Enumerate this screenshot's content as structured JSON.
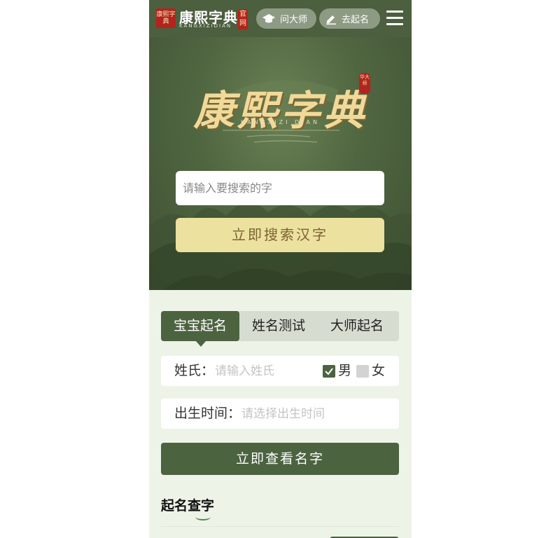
{
  "header": {
    "logo_seal": "康熙字典",
    "logo_name": "康熙字典",
    "logo_pinyin": "KANGXIZIDIAN",
    "logo_tag": "官网",
    "ask_label": "问大师",
    "naming_label": "去起名"
  },
  "hero": {
    "title": "康熙字典",
    "pinyin": "KANGXIZI DIAN",
    "seal": "华大师",
    "search_placeholder": "请输入要搜索的字",
    "search_button": "立即搜索汉字"
  },
  "tabs": [
    {
      "label": "宝宝起名",
      "active": true
    },
    {
      "label": "姓名测试",
      "active": false
    },
    {
      "label": "大师起名",
      "active": false
    }
  ],
  "form": {
    "surname_label": "姓氏：",
    "surname_placeholder": "请输入姓氏",
    "gender_male": "男",
    "gender_female": "女",
    "male_checked": true,
    "birth_label": "出生时间：",
    "birth_placeholder": "请选择出生时间",
    "submit": "立即查看名字"
  },
  "section": {
    "title": "起名查字"
  },
  "colors": {
    "brand_green": "#4c6340",
    "header_green": "#4c5f3e",
    "gold_button": "#ede19f",
    "seal_red": "#b3241c",
    "page_bg": "#eef3e8"
  }
}
